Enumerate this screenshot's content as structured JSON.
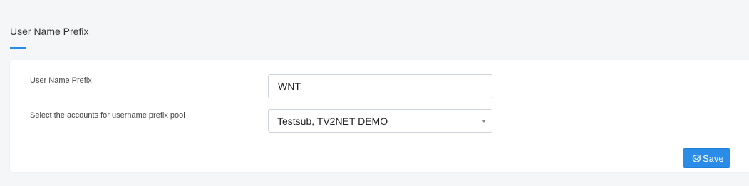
{
  "tabs": [
    {
      "label": "User Name Prefix",
      "active": true
    }
  ],
  "form": {
    "prefix_label": "User Name Prefix",
    "prefix_value": "WNT",
    "accounts_label": "Select the accounts for username prefix pool",
    "accounts_value": "Testsub, TV2NET DEMO"
  },
  "actions": {
    "save_label": "Save",
    "save_icon": "check-circle-icon"
  },
  "colors": {
    "accent": "#2b8ce8",
    "background": "#f5f6f8",
    "card": "#ffffff"
  }
}
